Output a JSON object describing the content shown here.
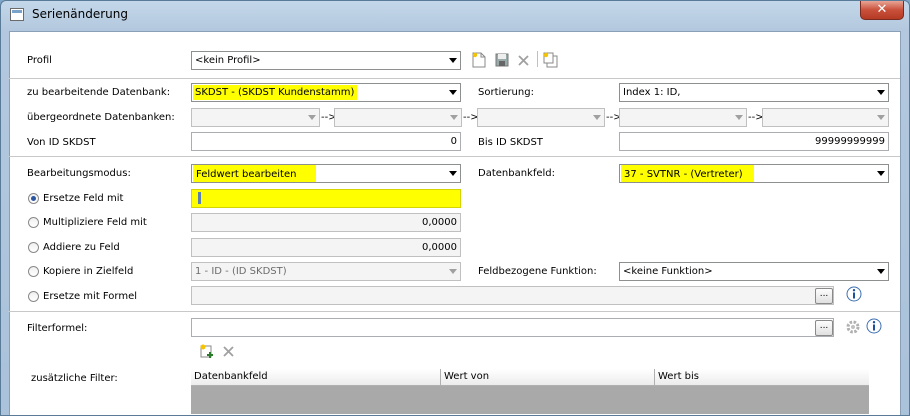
{
  "window": {
    "title": "Serienänderung",
    "close": "✕"
  },
  "profil": {
    "label": "Profil",
    "value": "<kein Profil>"
  },
  "datenbank": {
    "label": "zu bearbeitende Datenbank:",
    "value": "SKDST - (SKDST Kundenstamm)"
  },
  "sortierung": {
    "label": "Sortierung:",
    "value": "Index 1: ID,"
  },
  "uebergeordnet": {
    "label": "übergeordnete Datenbanken:",
    "arrow": "-->"
  },
  "von_id": {
    "label": "Von ID SKDST",
    "value": "0"
  },
  "bis_id": {
    "label": "Bis ID SKDST",
    "value": "99999999999"
  },
  "modus": {
    "label": "Bearbeitungsmodus:",
    "value": "Feldwert bearbeiten"
  },
  "datenbankfeld": {
    "label": "Datenbankfeld:",
    "value": "37 - SVTNR - (Vertreter)"
  },
  "ersetze_feld": {
    "label": "Ersetze Feld mit",
    "value": "",
    "selected": true
  },
  "multipliziere": {
    "label": "Multipliziere Feld mit",
    "value": "0,0000"
  },
  "addiere": {
    "label": "Addiere zu Feld",
    "value": "0,0000"
  },
  "kopiere": {
    "label": "Kopiere in Zielfeld",
    "value": "1 - ID - (ID SKDST)"
  },
  "feldfunktion": {
    "label": "Feldbezogene Funktion:",
    "value": "<keine Funktion>"
  },
  "formel": {
    "label": "Ersetze mit Formel",
    "button": "..."
  },
  "filterformel": {
    "label": "Filterformel:",
    "button": "..."
  },
  "zusaetzliche_filter": {
    "label": "zusätzliche Filter:",
    "columns": [
      "Datenbankfeld",
      "Wert von",
      "Wert bis"
    ]
  },
  "colors": {
    "highlight": "#ffff00",
    "title_close": "#c9503a"
  },
  "icons": [
    "new-profile-icon",
    "save-icon",
    "delete-icon",
    "copy-icon",
    "info-icon",
    "gear-icon",
    "add-filter-icon",
    "remove-filter-icon"
  ]
}
